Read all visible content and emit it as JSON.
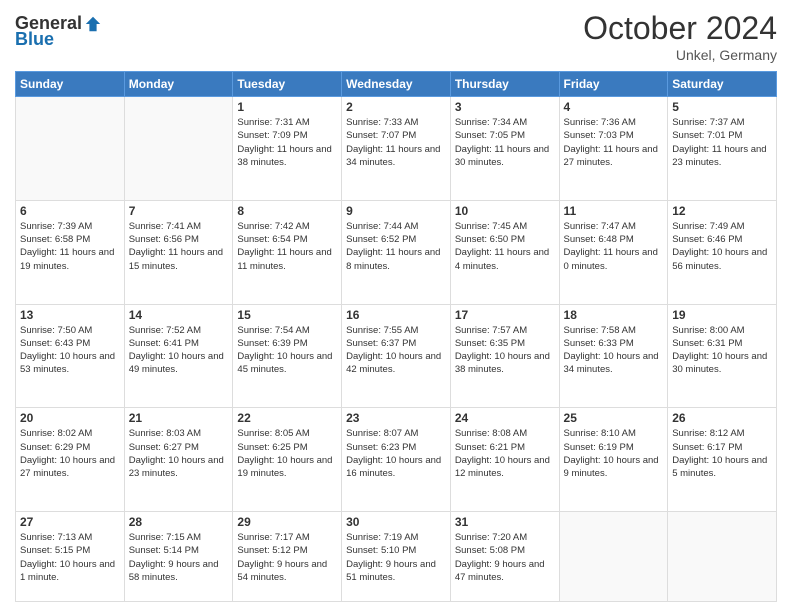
{
  "header": {
    "logo_general": "General",
    "logo_blue": "Blue",
    "month": "October 2024",
    "location": "Unkel, Germany"
  },
  "weekdays": [
    "Sunday",
    "Monday",
    "Tuesday",
    "Wednesday",
    "Thursday",
    "Friday",
    "Saturday"
  ],
  "weeks": [
    [
      {
        "day": "",
        "info": ""
      },
      {
        "day": "",
        "info": ""
      },
      {
        "day": "1",
        "info": "Sunrise: 7:31 AM\nSunset: 7:09 PM\nDaylight: 11 hours and 38 minutes."
      },
      {
        "day": "2",
        "info": "Sunrise: 7:33 AM\nSunset: 7:07 PM\nDaylight: 11 hours and 34 minutes."
      },
      {
        "day": "3",
        "info": "Sunrise: 7:34 AM\nSunset: 7:05 PM\nDaylight: 11 hours and 30 minutes."
      },
      {
        "day": "4",
        "info": "Sunrise: 7:36 AM\nSunset: 7:03 PM\nDaylight: 11 hours and 27 minutes."
      },
      {
        "day": "5",
        "info": "Sunrise: 7:37 AM\nSunset: 7:01 PM\nDaylight: 11 hours and 23 minutes."
      }
    ],
    [
      {
        "day": "6",
        "info": "Sunrise: 7:39 AM\nSunset: 6:58 PM\nDaylight: 11 hours and 19 minutes."
      },
      {
        "day": "7",
        "info": "Sunrise: 7:41 AM\nSunset: 6:56 PM\nDaylight: 11 hours and 15 minutes."
      },
      {
        "day": "8",
        "info": "Sunrise: 7:42 AM\nSunset: 6:54 PM\nDaylight: 11 hours and 11 minutes."
      },
      {
        "day": "9",
        "info": "Sunrise: 7:44 AM\nSunset: 6:52 PM\nDaylight: 11 hours and 8 minutes."
      },
      {
        "day": "10",
        "info": "Sunrise: 7:45 AM\nSunset: 6:50 PM\nDaylight: 11 hours and 4 minutes."
      },
      {
        "day": "11",
        "info": "Sunrise: 7:47 AM\nSunset: 6:48 PM\nDaylight: 11 hours and 0 minutes."
      },
      {
        "day": "12",
        "info": "Sunrise: 7:49 AM\nSunset: 6:46 PM\nDaylight: 10 hours and 56 minutes."
      }
    ],
    [
      {
        "day": "13",
        "info": "Sunrise: 7:50 AM\nSunset: 6:43 PM\nDaylight: 10 hours and 53 minutes."
      },
      {
        "day": "14",
        "info": "Sunrise: 7:52 AM\nSunset: 6:41 PM\nDaylight: 10 hours and 49 minutes."
      },
      {
        "day": "15",
        "info": "Sunrise: 7:54 AM\nSunset: 6:39 PM\nDaylight: 10 hours and 45 minutes."
      },
      {
        "day": "16",
        "info": "Sunrise: 7:55 AM\nSunset: 6:37 PM\nDaylight: 10 hours and 42 minutes."
      },
      {
        "day": "17",
        "info": "Sunrise: 7:57 AM\nSunset: 6:35 PM\nDaylight: 10 hours and 38 minutes."
      },
      {
        "day": "18",
        "info": "Sunrise: 7:58 AM\nSunset: 6:33 PM\nDaylight: 10 hours and 34 minutes."
      },
      {
        "day": "19",
        "info": "Sunrise: 8:00 AM\nSunset: 6:31 PM\nDaylight: 10 hours and 30 minutes."
      }
    ],
    [
      {
        "day": "20",
        "info": "Sunrise: 8:02 AM\nSunset: 6:29 PM\nDaylight: 10 hours and 27 minutes."
      },
      {
        "day": "21",
        "info": "Sunrise: 8:03 AM\nSunset: 6:27 PM\nDaylight: 10 hours and 23 minutes."
      },
      {
        "day": "22",
        "info": "Sunrise: 8:05 AM\nSunset: 6:25 PM\nDaylight: 10 hours and 19 minutes."
      },
      {
        "day": "23",
        "info": "Sunrise: 8:07 AM\nSunset: 6:23 PM\nDaylight: 10 hours and 16 minutes."
      },
      {
        "day": "24",
        "info": "Sunrise: 8:08 AM\nSunset: 6:21 PM\nDaylight: 10 hours and 12 minutes."
      },
      {
        "day": "25",
        "info": "Sunrise: 8:10 AM\nSunset: 6:19 PM\nDaylight: 10 hours and 9 minutes."
      },
      {
        "day": "26",
        "info": "Sunrise: 8:12 AM\nSunset: 6:17 PM\nDaylight: 10 hours and 5 minutes."
      }
    ],
    [
      {
        "day": "27",
        "info": "Sunrise: 7:13 AM\nSunset: 5:15 PM\nDaylight: 10 hours and 1 minute."
      },
      {
        "day": "28",
        "info": "Sunrise: 7:15 AM\nSunset: 5:14 PM\nDaylight: 9 hours and 58 minutes."
      },
      {
        "day": "29",
        "info": "Sunrise: 7:17 AM\nSunset: 5:12 PM\nDaylight: 9 hours and 54 minutes."
      },
      {
        "day": "30",
        "info": "Sunrise: 7:19 AM\nSunset: 5:10 PM\nDaylight: 9 hours and 51 minutes."
      },
      {
        "day": "31",
        "info": "Sunrise: 7:20 AM\nSunset: 5:08 PM\nDaylight: 9 hours and 47 minutes."
      },
      {
        "day": "",
        "info": ""
      },
      {
        "day": "",
        "info": ""
      }
    ]
  ]
}
